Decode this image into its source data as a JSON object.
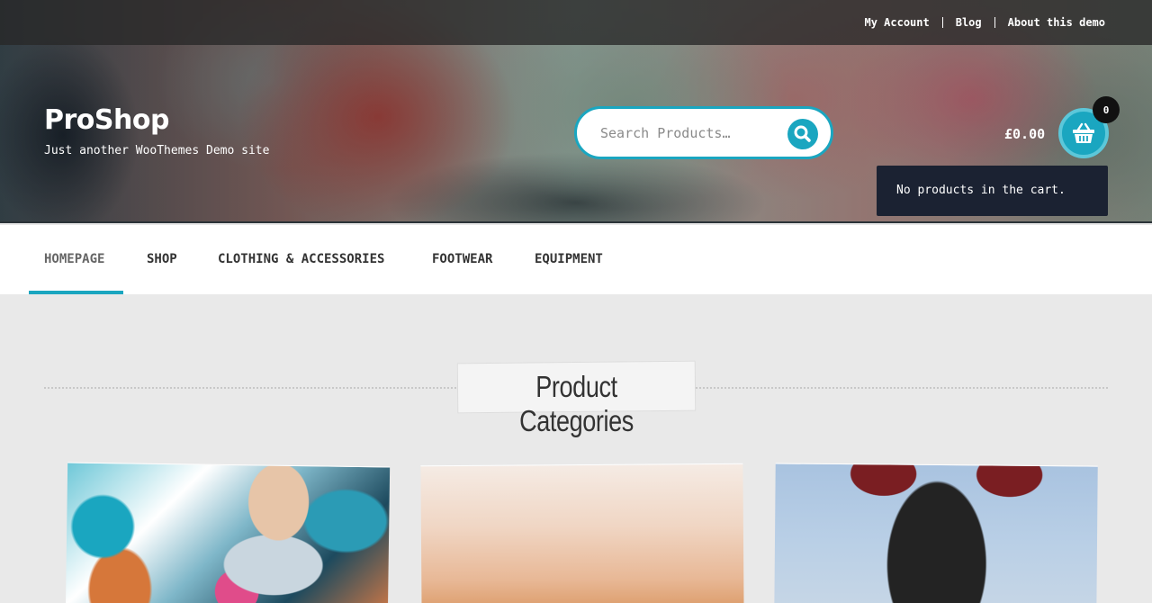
{
  "topbar": {
    "links": [
      "My Account",
      "Blog",
      "About this demo"
    ]
  },
  "site": {
    "title": "ProShop",
    "description": "Just another WooThemes Demo site"
  },
  "search": {
    "placeholder": "Search Products…",
    "icon": "search-icon"
  },
  "cart": {
    "total": "£0.00",
    "count": "0",
    "empty_message": "No products in the cart.",
    "icon": "basket-icon"
  },
  "nav": {
    "items": [
      "HOMEPAGE",
      "SHOP",
      "CLOTHING & ACCESSORIES",
      "FOOTWEAR",
      "EQUIPMENT"
    ],
    "active": "HOMEPAGE"
  },
  "section": {
    "title": "Product Categories"
  },
  "colors": {
    "accent": "#1aa6c0",
    "dark": "#1b2232"
  }
}
